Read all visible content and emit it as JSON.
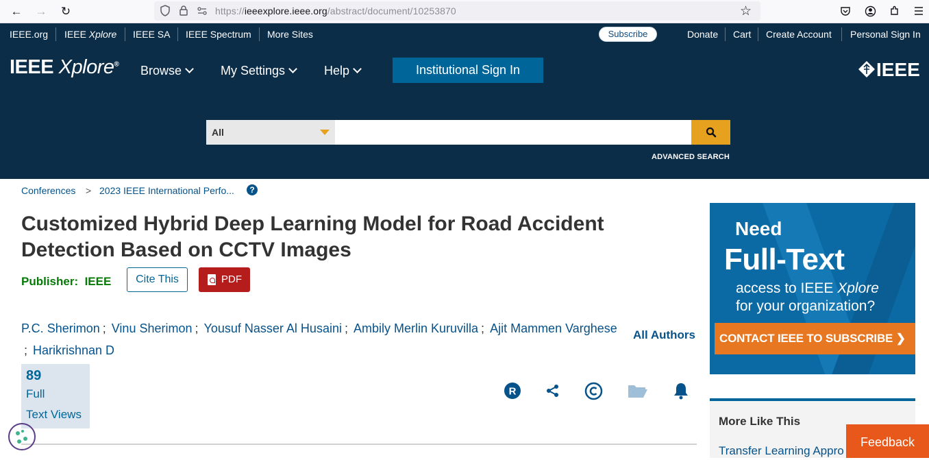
{
  "browser": {
    "url_prefix": "https://",
    "url_host": "ieeexplore.ieee.org",
    "url_path": "/abstract/document/10253870"
  },
  "topbar": {
    "links": [
      "IEEE.org",
      "IEEE Xplore",
      "IEEE SA",
      "IEEE Spectrum",
      "More Sites"
    ],
    "subscribe": "Subscribe",
    "right_links": [
      "Donate",
      "Cart",
      "Create Account",
      "Personal Sign In"
    ]
  },
  "header": {
    "logo_main": "IEEE",
    "logo_italic": "Xplore",
    "logo_reg": "®",
    "menu": [
      "Browse",
      "My Settings",
      "Help"
    ],
    "institutional_sign_in": "Institutional Sign In",
    "brand": "IEEE"
  },
  "search": {
    "scope": "All",
    "placeholder": "",
    "advanced": "ADVANCED SEARCH"
  },
  "breadcrumb": {
    "level1": "Conferences",
    "separator": ">",
    "level2": "2023 IEEE International Perfo..."
  },
  "article": {
    "title": "Customized Hybrid Deep Learning Model for Road Accident Detection Based on CCTV Images",
    "publisher_label": "Publisher:",
    "publisher": "IEEE",
    "cite": "Cite This",
    "pdf": "PDF",
    "authors": [
      "P.C. Sherimon",
      "Vinu Sherimon",
      "Yousuf Nasser Al Husaini",
      "Ambily Merlin Kuruvilla",
      "Ajit Mammen Varghese",
      "Harikrishnan D"
    ],
    "author_sep": ";",
    "all_authors": "All Authors",
    "metric_value": "89",
    "metric_label_1": "Full",
    "metric_label_2": "Text Views"
  },
  "ad": {
    "line1": "Need",
    "line2": "Full-Text",
    "line3a": "access to IEEE ",
    "line3b": "Xplore",
    "line4": "for your organization?",
    "cta": "CONTACT IEEE TO SUBSCRIBE"
  },
  "more_like_this": {
    "title": "More Like This",
    "first_link": "Transfer Learning Appro"
  },
  "feedback": "Feedback",
  "colors": {
    "header_bg": "#0c2d48",
    "link": "#06528a",
    "publisher_green": "#067a06",
    "pdf_red": "#b51c1c",
    "search_accent": "#e6a11e",
    "feedback_orange": "#e8581a"
  }
}
